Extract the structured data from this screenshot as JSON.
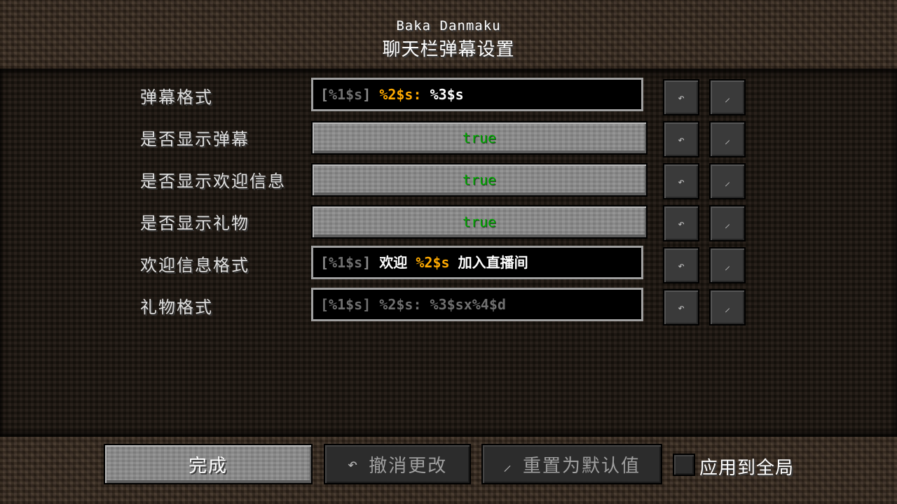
{
  "header": {
    "mod_name": "Baka Danmaku",
    "screen_title": "聊天栏弹幕设置"
  },
  "rows": [
    {
      "label": "弹幕格式",
      "type": "text",
      "segments": [
        {
          "text": "[",
          "color": "gray"
        },
        {
          "text": "%1$s",
          "color": "dim"
        },
        {
          "text": "] ",
          "color": "gray"
        },
        {
          "text": "%2$s: ",
          "color": "gold"
        },
        {
          "text": "%3$s",
          "color": "white"
        }
      ]
    },
    {
      "label": "是否显示弹幕",
      "type": "toggle",
      "value": "true"
    },
    {
      "label": "是否显示欢迎信息",
      "type": "toggle",
      "value": "true"
    },
    {
      "label": "是否显示礼物",
      "type": "toggle",
      "value": "true"
    },
    {
      "label": "欢迎信息格式",
      "type": "text",
      "segments": [
        {
          "text": "[",
          "color": "gray"
        },
        {
          "text": "%1$s",
          "color": "dim"
        },
        {
          "text": "] ",
          "color": "gray"
        },
        {
          "text": "欢迎 ",
          "color": "white"
        },
        {
          "text": "%2$s ",
          "color": "gold"
        },
        {
          "text": "加入直播间",
          "color": "white"
        }
      ]
    },
    {
      "label": "礼物格式",
      "type": "text",
      "inactive": true,
      "segments": [
        {
          "text": "[%1$s] %2$s: %3$sx%4$d",
          "color": "dim"
        }
      ]
    }
  ],
  "row_buttons": {
    "undo_icon": "↶",
    "reset_icon": "⸝"
  },
  "footer": {
    "done_label": "完成",
    "undo_all_icon": "↶",
    "undo_all_label": "撤消更改",
    "reset_all_icon": "⸝",
    "reset_all_label": "重置为默认值",
    "apply_global_label": "应用到全局"
  },
  "colors": {
    "gold": "#ffaa00",
    "toggle_true": "#00aa00",
    "field_border": "#a0a0a0"
  }
}
